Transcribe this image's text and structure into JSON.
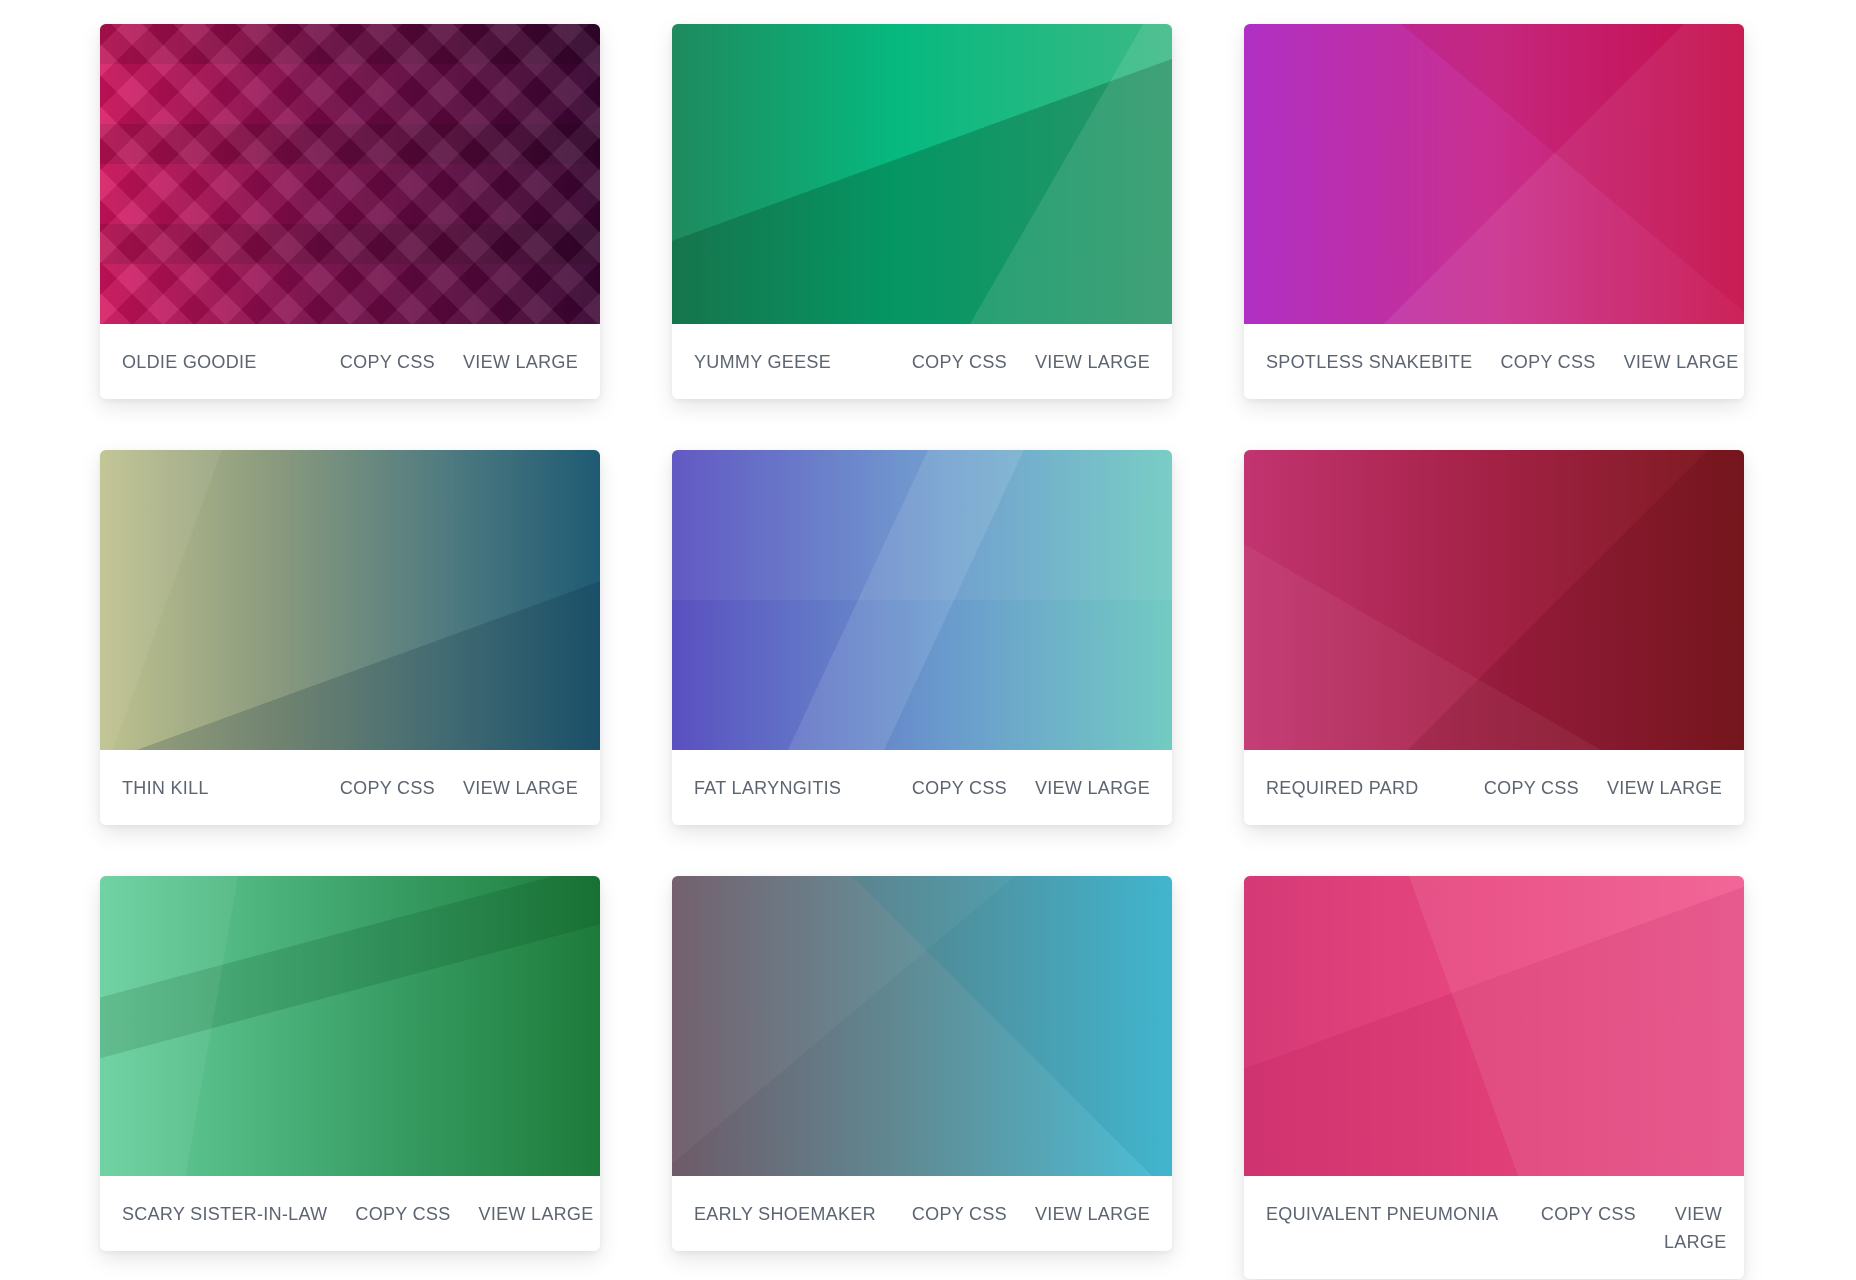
{
  "actions": {
    "copy_css": "COPY CSS",
    "view_large": "VIEW LARGE"
  },
  "gradients": [
    {
      "name": "OLDIE GOODIE",
      "from": "#d6135f",
      "to": "#3a0433",
      "style": "plaid"
    },
    {
      "name": "YUMMY GEESE",
      "from": "#0a8a58",
      "to": "#3cb985",
      "mid": "#06b97f",
      "style": "shard"
    },
    {
      "name": "SPOTLESS SNAKEBITE",
      "from": "#b02fc4",
      "to": "#c8104a",
      "mid": "#c92f8e",
      "style": "shard"
    },
    {
      "name": "THIN KILL",
      "from": "#bfc28f",
      "to": "#1f5a73",
      "mid": "#6e8a7d",
      "style": "shard"
    },
    {
      "name": "FAT LARYNGITIS",
      "from": "#5a50c0",
      "to": "#72cbc2",
      "mid": "#6a9bcd",
      "style": "shard"
    },
    {
      "name": "REQUIRED PARD",
      "from": "#c23470",
      "to": "#7a1a1e",
      "mid": "#a32145",
      "style": "shard"
    },
    {
      "name": "SCARY SISTER-IN-LAW",
      "from": "#68d09e",
      "to": "#1d7b3a",
      "mid": "#3aa067",
      "style": "shard"
    },
    {
      "name": "EARLY SHOEMAKER",
      "from": "#6e5a68",
      "to": "#4cc0d8",
      "mid": "#5e8e97",
      "style": "shard"
    },
    {
      "name": "EQUIVALENT PNEUMONIA",
      "from": "#d53a76",
      "to": "#f0598f",
      "mid": "#e9477f",
      "style": "shard"
    }
  ]
}
